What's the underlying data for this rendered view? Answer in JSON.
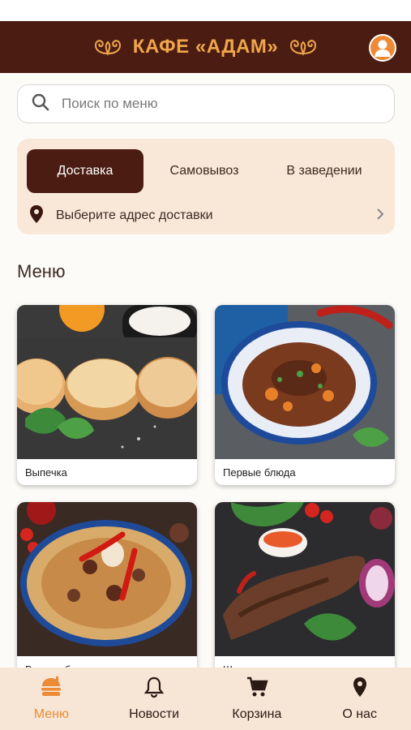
{
  "header": {
    "title": "КАФЕ «АДАМ»"
  },
  "search": {
    "placeholder": "Поиск по меню"
  },
  "delivery": {
    "tabs": [
      {
        "label": "Доставка",
        "active": true
      },
      {
        "label": "Самовывоз",
        "active": false
      },
      {
        "label": "В заведении",
        "active": false
      }
    ],
    "address_prompt": "Выберите адрес доставки"
  },
  "menu": {
    "title": "Меню",
    "categories": [
      {
        "label": "Выпечка"
      },
      {
        "label": "Первые блюда"
      },
      {
        "label": "Вторые блюда"
      },
      {
        "label": "Шашлык"
      }
    ]
  },
  "bottom_nav": [
    {
      "label": "Меню",
      "icon": "burger-icon",
      "active": true
    },
    {
      "label": "Новости",
      "icon": "bell-icon",
      "active": false
    },
    {
      "label": "Корзина",
      "icon": "cart-icon",
      "active": false
    },
    {
      "label": "О нас",
      "icon": "location-pin-icon",
      "active": false
    }
  ],
  "colors": {
    "brand_dark": "#4a1c12",
    "brand_orange": "#ec8a35",
    "card_bg": "#f9e8d8"
  }
}
